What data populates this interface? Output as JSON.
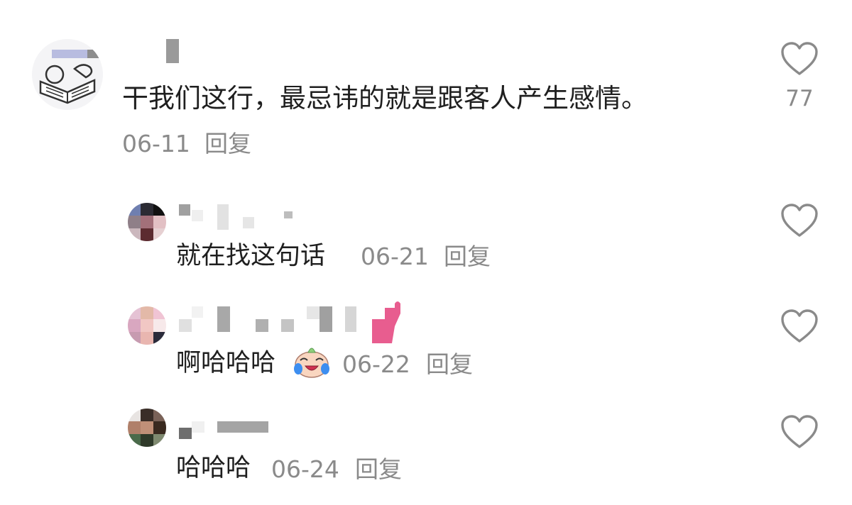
{
  "main_comment": {
    "text": "干我们这行，最忌讳的就是跟客人产生感情。",
    "date": "06-11",
    "reply_label": "回复",
    "like_count": "77"
  },
  "replies": [
    {
      "text": "就在找这句话",
      "date": "06-21",
      "reply_label": "回复"
    },
    {
      "text": "啊哈哈哈",
      "date": "06-22",
      "reply_label": "回复",
      "emoji": "laughing-crying-face-emoji"
    },
    {
      "text": "哈哈哈",
      "date": "06-24",
      "reply_label": "回复"
    }
  ],
  "colors": {
    "text": "#1f1f1f",
    "meta": "#8a8a8a",
    "heart": "#8a8a8a",
    "background": "#ffffff"
  },
  "icons": [
    "heart-icon",
    "avatar",
    "laughing-crying-face-emoji"
  ]
}
